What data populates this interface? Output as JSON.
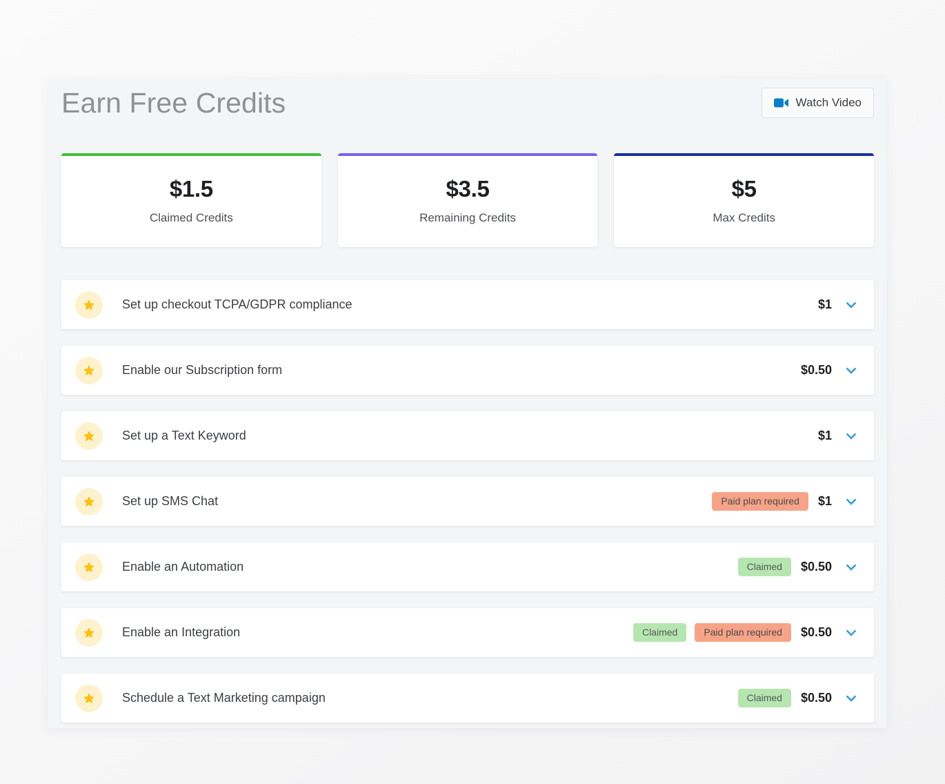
{
  "header": {
    "title": "Earn Free Credits",
    "watch_video_label": "Watch Video",
    "video_icon": "video-camera-icon",
    "video_icon_color": "#0b7fc4"
  },
  "stats": [
    {
      "value": "$1.5",
      "label": "Claimed Credits",
      "accent": "#3ec03e"
    },
    {
      "value": "$3.5",
      "label": "Remaining Credits",
      "accent": "#7761ee"
    },
    {
      "value": "$5",
      "label": "Max Credits",
      "accent": "#19319b"
    }
  ],
  "tasks": [
    {
      "icon": "star-icon",
      "label": "Set up checkout TCPA/GDPR compliance",
      "price": "$1",
      "badges": [],
      "chevron": "chevron-down-icon"
    },
    {
      "icon": "star-icon",
      "label": "Enable our Subscription form",
      "price": "$0.50",
      "badges": [],
      "chevron": "chevron-down-icon"
    },
    {
      "icon": "star-icon",
      "label": "Set up a Text Keyword",
      "price": "$1",
      "badges": [],
      "chevron": "chevron-down-icon"
    },
    {
      "icon": "star-icon",
      "label": "Set up SMS Chat",
      "price": "$1",
      "badges": [
        {
          "text": "Paid plan required",
          "kind": "paid"
        }
      ],
      "chevron": "chevron-down-icon"
    },
    {
      "icon": "star-icon",
      "label": "Enable an Automation",
      "price": "$0.50",
      "badges": [
        {
          "text": "Claimed",
          "kind": "claimed"
        }
      ],
      "chevron": "chevron-down-icon"
    },
    {
      "icon": "star-icon",
      "label": "Enable an Integration",
      "price": "$0.50",
      "badges": [
        {
          "text": "Claimed",
          "kind": "claimed"
        },
        {
          "text": "Paid plan required",
          "kind": "paid"
        }
      ],
      "chevron": "chevron-down-icon"
    },
    {
      "icon": "star-icon",
      "label": "Schedule a Text Marketing campaign",
      "price": "$0.50",
      "badges": [
        {
          "text": "Claimed",
          "kind": "claimed"
        }
      ],
      "chevron": "chevron-down-icon"
    }
  ],
  "colors": {
    "page_background": "#f8f8f9",
    "panel_background": "#f4f5f7",
    "card_background": "#ffffff",
    "star_circle": "#fdf2cd",
    "star_fill": "#fcc016",
    "chevron": "#3f9ed2",
    "badge_claimed_bg": "#b6e6b0",
    "badge_paid_bg": "#f7a388",
    "title_text": "#8e9196"
  }
}
